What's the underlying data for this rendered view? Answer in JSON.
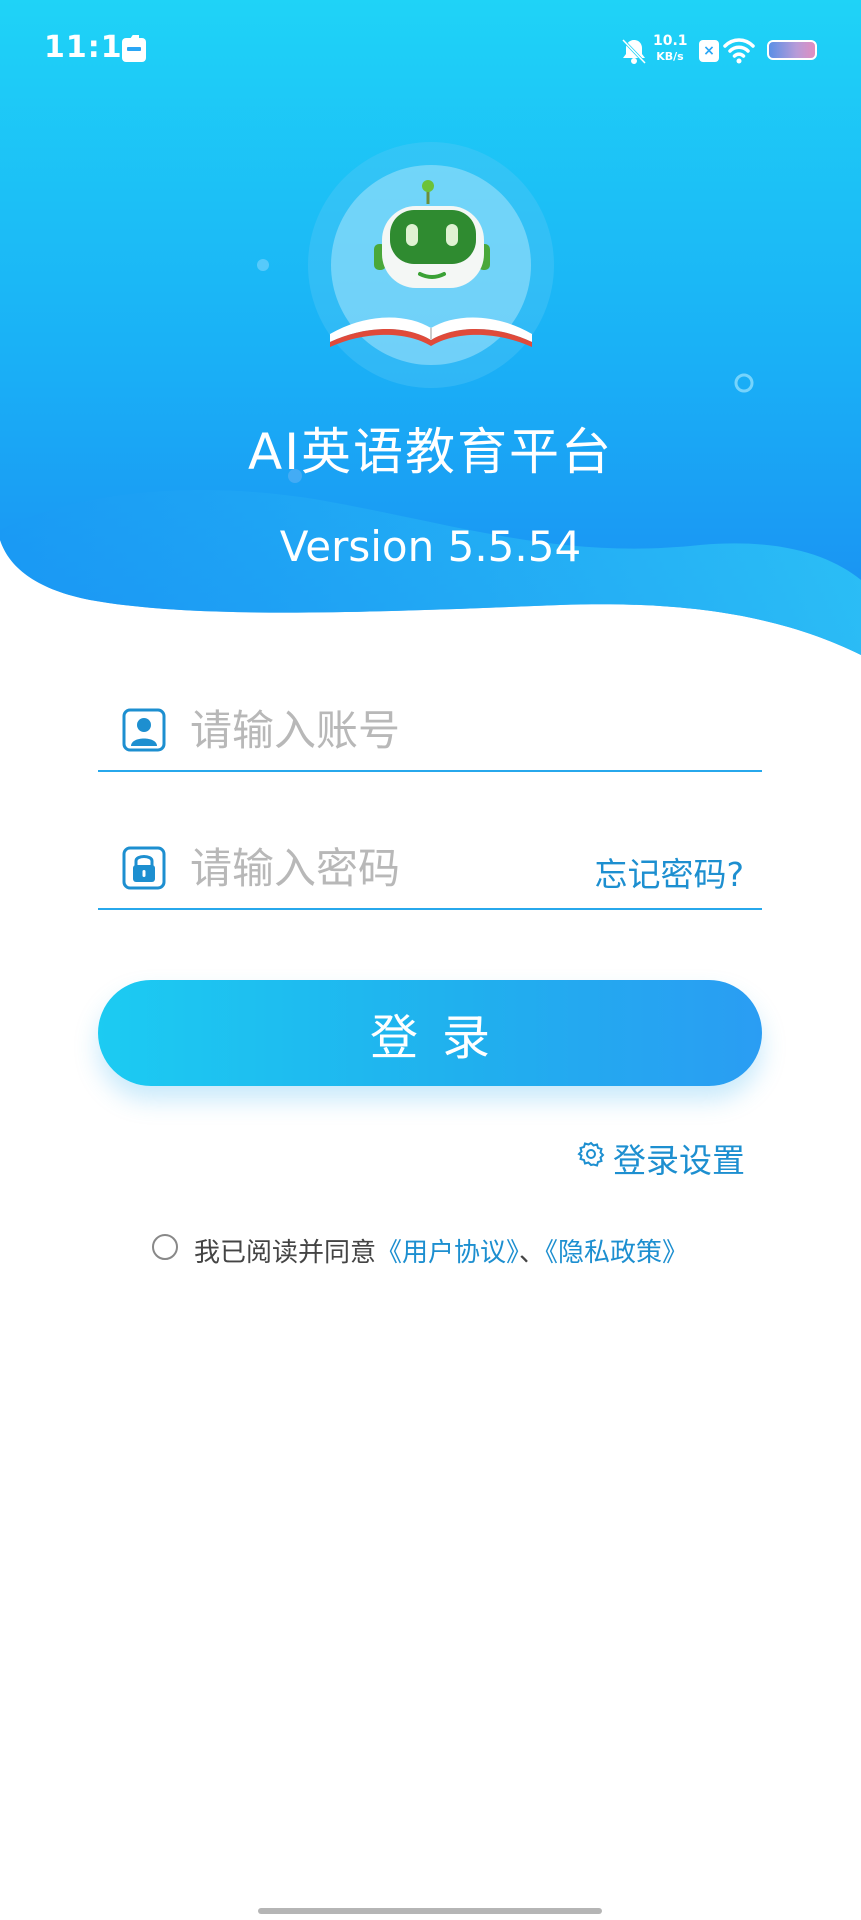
{
  "status_bar": {
    "time": "11:14",
    "net_speed_value": "10.1",
    "net_speed_unit": "KB/s"
  },
  "app": {
    "title": "AI英语教育平台",
    "version": "Version 5.5.54"
  },
  "form": {
    "account_placeholder": "请输入账号",
    "password_placeholder": "请输入密码",
    "forgot_password": "忘记密码?",
    "login_button": "登录",
    "login_settings": "登录设置"
  },
  "agreement": {
    "prefix": "我已阅读并同意",
    "user_agreement": "《用户协议》",
    "separator": "、",
    "privacy_policy": "《隐私政策》",
    "checked": false
  },
  "colors": {
    "accent": "#1d8fd0",
    "header_top": "#1fd3f7",
    "header_bottom": "#1a8cf2",
    "button_start": "#1ccbf2",
    "button_end": "#2a9df3"
  },
  "icons": {
    "account": "user-icon",
    "password": "lock-icon",
    "settings": "gear-icon",
    "logo": "robot-book-logo"
  }
}
